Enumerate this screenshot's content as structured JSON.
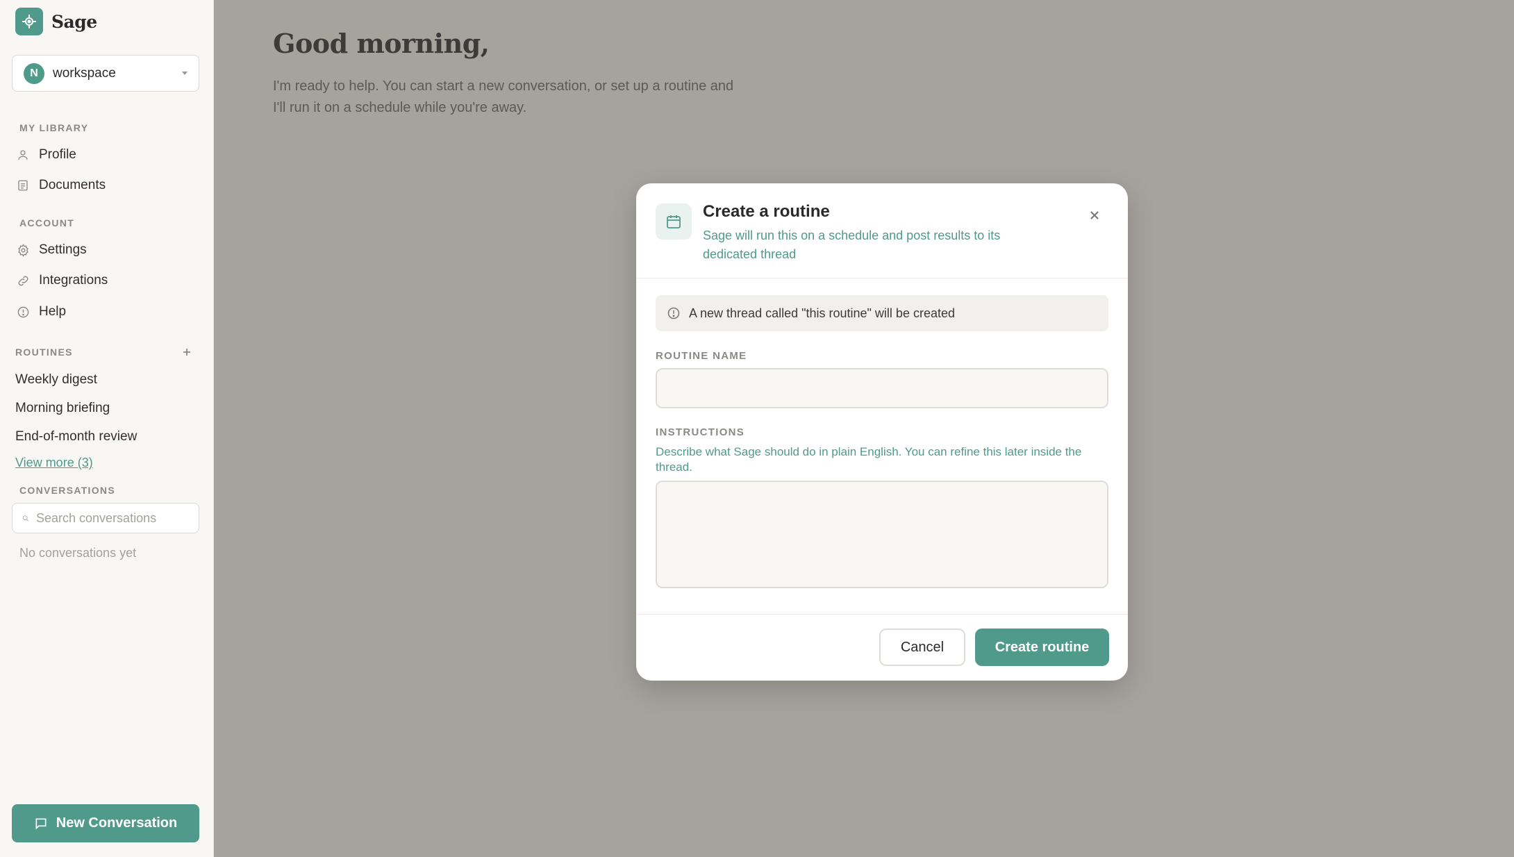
{
  "app": {
    "name": "Sage",
    "logo_icon": "compass-icon"
  },
  "workspace": {
    "initial": "N",
    "name": "workspace"
  },
  "sidebar": {
    "library_label": "MY LIBRARY",
    "library_items": [
      {
        "label": "Profile",
        "icon": "user-icon"
      },
      {
        "label": "Documents",
        "icon": "document-icon"
      }
    ],
    "account_label": "ACCOUNT",
    "account_items": [
      {
        "label": "Settings",
        "icon": "gear-icon"
      },
      {
        "label": "Integrations",
        "icon": "link-icon"
      },
      {
        "label": "Help",
        "icon": "info-icon"
      }
    ],
    "routines_label": "ROUTINES",
    "routines": [
      "Weekly digest",
      "Morning briefing",
      "End-of-month review"
    ],
    "view_more": "View more (3)",
    "conversations_label": "CONVERSATIONS",
    "search_placeholder": "Search conversations",
    "empty_conversations": "No conversations yet",
    "new_conversation": "New Conversation"
  },
  "main": {
    "greeting": "Good morning,",
    "intro": "I'm ready to help. You can start a new conversation, or set up a routine and I'll run it on a schedule while you're away."
  },
  "modal": {
    "title": "Create a routine",
    "subtitle": "Sage will run this on a schedule and post results to its dedicated thread",
    "info": "A new thread called \"this routine\" will be created",
    "name_label": "ROUTINE NAME",
    "name_value": "",
    "instructions_label": "INSTRUCTIONS",
    "instructions_help": "Describe what Sage should do in plain English. You can refine this later inside the thread.",
    "instructions_value": "",
    "cancel": "Cancel",
    "create": "Create routine"
  },
  "colors": {
    "accent": "#4f9a8b",
    "overlay": "#a6a39d",
    "sidebar_bg": "#f8f7f4"
  }
}
